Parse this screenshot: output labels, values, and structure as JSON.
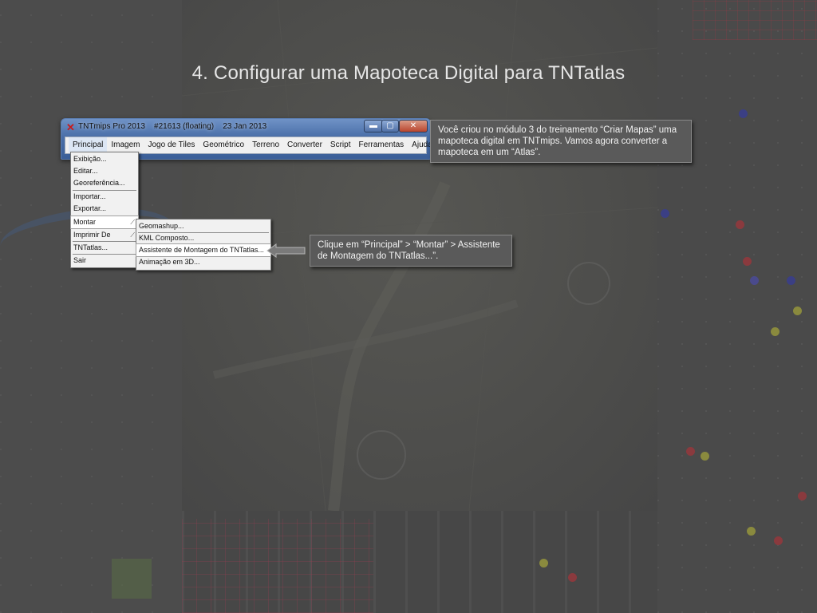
{
  "slide": {
    "title": "4. Configurar uma Mapoteca Digital para TNTatlas"
  },
  "window": {
    "title": "TNTmips Pro 2013    #21613 (floating)    23 Jan 2013",
    "controls": {
      "minimize": "▬",
      "maximize": "▢",
      "close": "✕"
    }
  },
  "menubar": {
    "items": [
      "Principal",
      "Imagem",
      "Jogo de Tiles",
      "Geométrico",
      "Terreno",
      "Converter",
      "Script",
      "Ferramentas",
      "Ajuda"
    ]
  },
  "principal_menu": {
    "items": [
      "Exibição...",
      "Editar...",
      "Georeferência...",
      "Importar...",
      "Exportar...",
      "Montar",
      "Imprimir De",
      "TNTatlas...",
      "Sair"
    ]
  },
  "montar_submenu": {
    "items": [
      "Geomashup...",
      "KML Composto...",
      "Assistente de Montagem do TNTatlas...",
      "Animação em 3D..."
    ]
  },
  "callouts": {
    "intro": "Você criou no módulo 3 do treinamento “Criar Mapas” uma mapoteca digital em TNTmips. Vamos agora converter a mapoteca em um “Atlas”.",
    "instruction": "Clique em “Principal” > “Montar” > Assistente de Montagem do TNTatlas...”."
  },
  "colors": {
    "background": "#484848",
    "callout": "#5a5a5a",
    "titlebar": "#4a6fa8",
    "menu": "#f1f1f1"
  }
}
